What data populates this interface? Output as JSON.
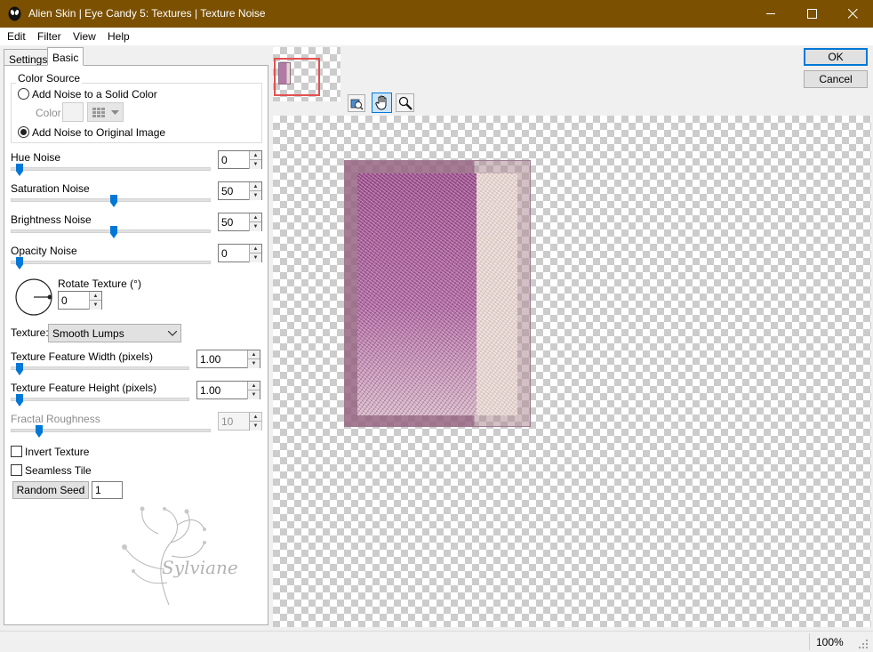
{
  "window": {
    "title": "Alien Skin | Eye Candy 5: Textures | Texture Noise",
    "accent_color": "#7b5000"
  },
  "menu": [
    "Edit",
    "Filter",
    "View",
    "Help"
  ],
  "tabs": [
    {
      "label": "Settings",
      "active": false
    },
    {
      "label": "Basic",
      "active": true
    }
  ],
  "color_source": {
    "label": "Color Source",
    "option_solid": "Add Noise to a Solid Color",
    "color_label": "Color",
    "option_original": "Add Noise to Original Image",
    "selected": "original"
  },
  "sliders": [
    {
      "label": "Hue Noise",
      "value": "0",
      "fraction": 0.0
    },
    {
      "label": "Saturation Noise",
      "value": "50",
      "fraction": 0.5
    },
    {
      "label": "Brightness Noise",
      "value": "50",
      "fraction": 0.5
    },
    {
      "label": "Opacity Noise",
      "value": "0",
      "fraction": 0.0
    }
  ],
  "rotate": {
    "label": "Rotate Texture (°)",
    "value": "0"
  },
  "texture": {
    "label": "Texture:",
    "selected": "Smooth Lumps"
  },
  "feature_sliders": [
    {
      "label": "Texture Feature Width (pixels)",
      "value": "1.00",
      "fraction": 0.0
    },
    {
      "label": "Texture Feature Height (pixels)",
      "value": "1.00",
      "fraction": 0.0
    },
    {
      "label": "Fractal Roughness",
      "value": "10",
      "fraction": 0.1,
      "disabled": true
    }
  ],
  "checks": {
    "invert": "Invert Texture",
    "seamless": "Seamless Tile"
  },
  "seed": {
    "button": "Random Seed",
    "value": "1"
  },
  "watermark": {
    "text": "Sylviane"
  },
  "buttons": {
    "ok": "OK",
    "cancel": "Cancel"
  },
  "tools": [
    "zoom-reset-tool-icon",
    "hand-tool-icon",
    "magnifier-tool-icon"
  ],
  "status": {
    "zoom": "100%"
  },
  "preview_colors": {
    "noise": "#a35a94",
    "light": "#eadbd4",
    "frame": "#b48fa4"
  }
}
